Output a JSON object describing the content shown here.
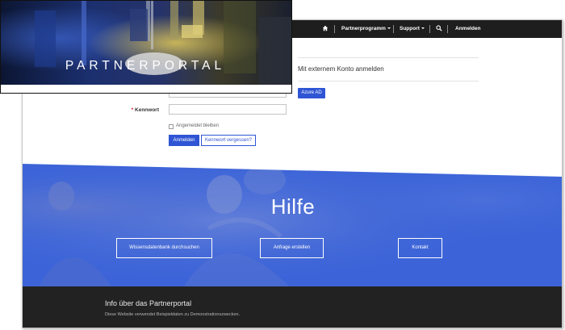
{
  "nav": {
    "home_icon": "home-icon",
    "partnerprogramm": "Partnerprogramm",
    "support": "Support",
    "search_icon": "search-icon",
    "anmelden": "Anmelden"
  },
  "banner": {
    "title": "PARTNERPORTAL"
  },
  "login": {
    "external_title": "Mit externem Konto anmelden",
    "azure_button": "Azure AD",
    "password_label": "Kennwort",
    "required_mark": "*",
    "remember_label": "Angemeldet bleiben",
    "submit_button": "Anmelden",
    "forgot_button": "Kennwort vergessen?"
  },
  "help": {
    "title": "Hilfe",
    "buttons": [
      "Wissensdatenbank durchsuchen",
      "Anfrage erstellen",
      "Kontakt"
    ]
  },
  "footer": {
    "title": "Info über das Partnerportal",
    "text": "Diese Website verwendet Beispieldaten zu Demonstrationszwecken."
  },
  "colors": {
    "accent": "#2f55d4",
    "help_bg": "#3c64d8",
    "nav_bg": "#1e1e1e",
    "footer_bg": "#222222"
  }
}
